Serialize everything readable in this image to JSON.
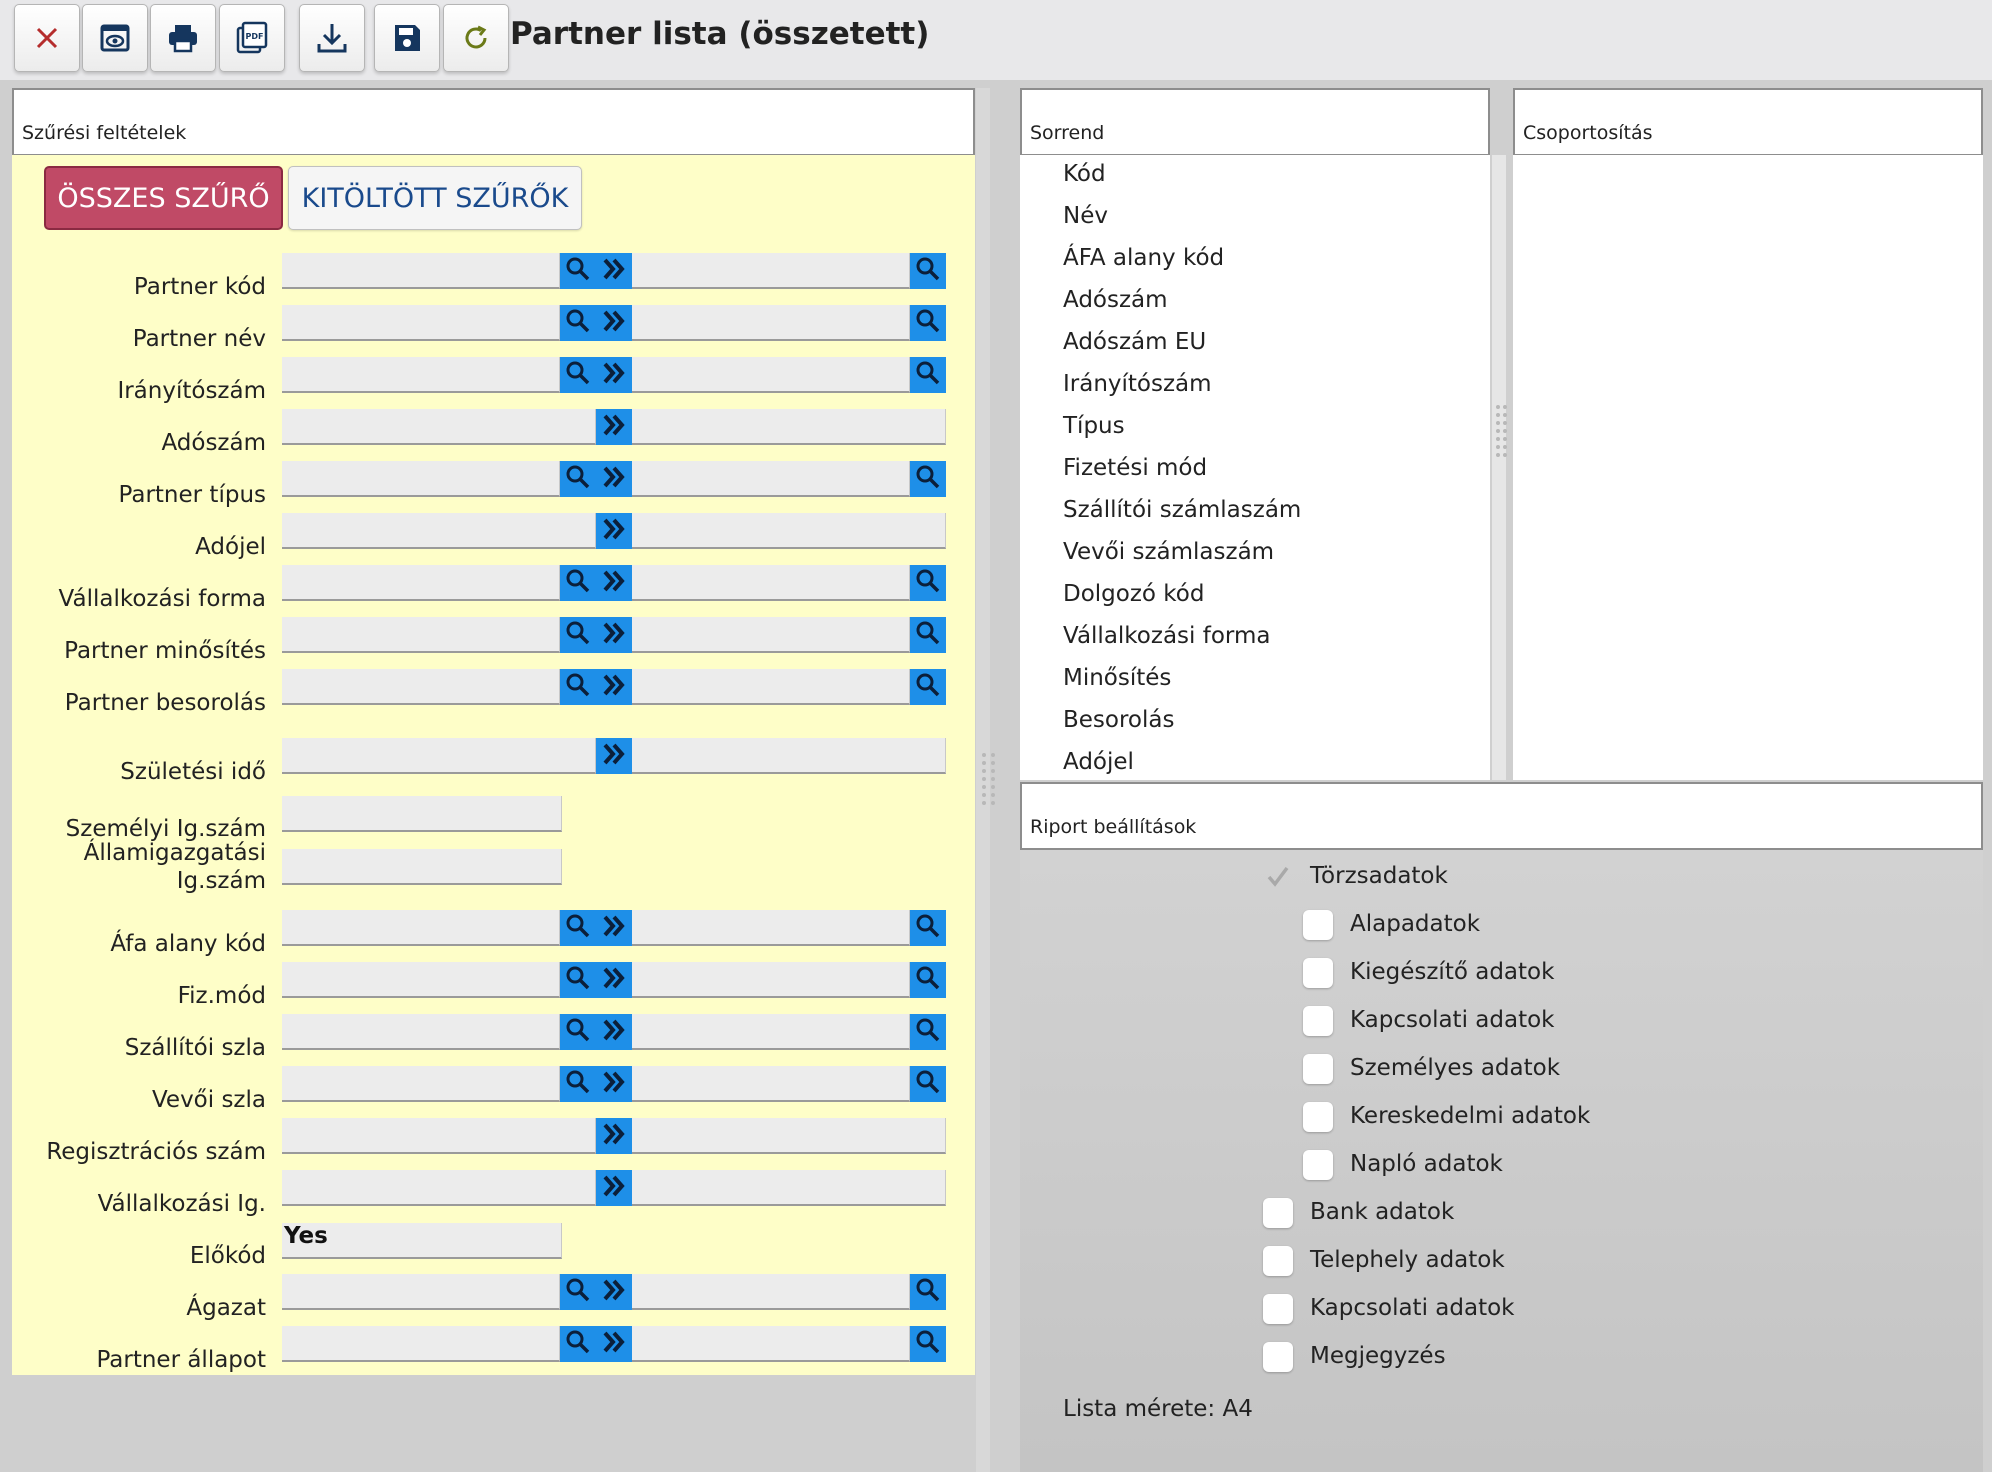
{
  "page": {
    "title": "Partner lista (összetett)"
  },
  "toolbar": {
    "buttons": [
      {
        "name": "close-button",
        "icon": "close-icon"
      },
      {
        "name": "preview-button",
        "icon": "preview-icon"
      },
      {
        "name": "print-button",
        "icon": "printer-icon"
      },
      {
        "name": "pdf-button",
        "icon": "pdf-icon",
        "icon_text": "PDF"
      },
      {
        "name": "download-button",
        "icon": "download-icon"
      },
      {
        "name": "save-button",
        "icon": "floppy-disk-icon"
      },
      {
        "name": "refresh-button",
        "icon": "refresh-icon"
      }
    ]
  },
  "filters": {
    "header": "Szűrési feltételek",
    "all_label": "ÖSSZES SZŰRŐ",
    "filled_label": "KITÖLTÖTT SZŰRŐK",
    "rows": [
      {
        "label": "Partner kód",
        "type": "range-search"
      },
      {
        "label": "Partner név",
        "type": "range-search"
      },
      {
        "label": "Irányítószám",
        "type": "range-search"
      },
      {
        "label": "Adószám",
        "type": "range"
      },
      {
        "label": "Partner típus",
        "type": "range-search"
      },
      {
        "label": "Adójel",
        "type": "range"
      },
      {
        "label": "Vállalkozási forma",
        "type": "range-search"
      },
      {
        "label": "Partner minősítés",
        "type": "range-search"
      },
      {
        "label": "Partner besorolás",
        "type": "range-search"
      },
      {
        "label": "Születési idő",
        "type": "range"
      },
      {
        "label": "Személyi Ig.szám",
        "type": "single"
      },
      {
        "label": "Államigazgatási Ig.szám",
        "type": "single"
      },
      {
        "label": "Áfa alany kód",
        "type": "range-search"
      },
      {
        "label": "Fiz.mód",
        "type": "range-search"
      },
      {
        "label": "Szállítói szla",
        "type": "range-search"
      },
      {
        "label": "Vevői szla",
        "type": "range-search"
      },
      {
        "label": "Regisztrációs szám",
        "type": "range"
      },
      {
        "label": "Vállalkozási Ig.",
        "type": "range"
      },
      {
        "label": "Előkód",
        "type": "single",
        "value": "Yes"
      },
      {
        "label": "Ágazat",
        "type": "range-search"
      },
      {
        "label": "Partner állapot",
        "type": "range-search"
      }
    ]
  },
  "sort": {
    "header": "Sorrend",
    "items": [
      "Kód",
      "Név",
      "ÁFA alany kód",
      "Adószám",
      "Adószám EU",
      "Irányítószám",
      "Típus",
      "Fizetési mód",
      "Szállítói számlaszám",
      "Vevői számlaszám",
      "Dolgozó kód",
      "Vállalkozási forma",
      "Minősítés",
      "Besorolás",
      "Adójel"
    ]
  },
  "grouping": {
    "header": "Csoportosítás"
  },
  "report": {
    "header": "Riport beállítások",
    "options": [
      {
        "label": "Törzsadatok",
        "checked": true,
        "disabled": true,
        "indent": 0
      },
      {
        "label": "Alapadatok",
        "checked": false,
        "indent": 1
      },
      {
        "label": "Kiegészítő adatok",
        "checked": false,
        "indent": 1
      },
      {
        "label": "Kapcsolati adatok",
        "checked": false,
        "indent": 1
      },
      {
        "label": "Személyes adatok",
        "checked": false,
        "indent": 1
      },
      {
        "label": "Kereskedelmi adatok",
        "checked": false,
        "indent": 1
      },
      {
        "label": "Napló adatok",
        "checked": false,
        "indent": 1
      },
      {
        "label": "Bank adatok",
        "checked": false,
        "indent": 0
      },
      {
        "label": "Telephely adatok",
        "checked": false,
        "indent": 0
      },
      {
        "label": "Kapcsolati adatok",
        "checked": false,
        "indent": 0
      },
      {
        "label": "Megjegyzés",
        "checked": false,
        "indent": 0
      }
    ],
    "list_size_label": "Lista mérete: A4"
  },
  "colors": {
    "accent_button": "#c04a66",
    "filter_background": "#fefec8",
    "input_button": "#1e8fe8",
    "close_icon": "#b52d2d",
    "refresh_icon": "#6b7a18"
  }
}
